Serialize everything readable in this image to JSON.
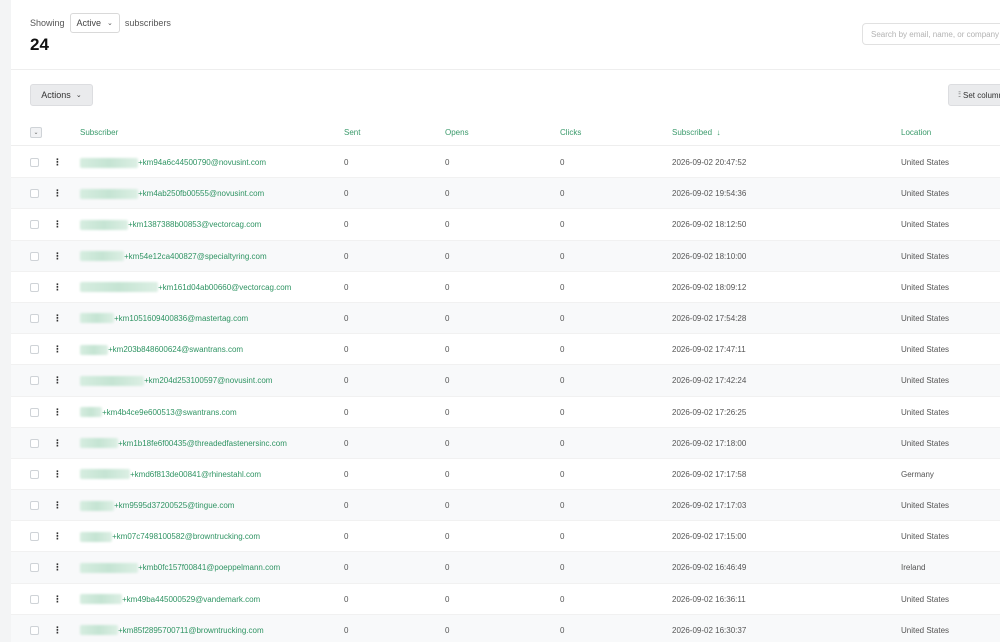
{
  "header": {
    "showing_label": "Showing",
    "status_value": "Active",
    "subscribers_label": "subscribers",
    "count": "24"
  },
  "search": {
    "placeholder": "Search by email, name, or company"
  },
  "toolbar": {
    "actions_label": "Actions",
    "set_columns_label": "Set columns"
  },
  "columns": {
    "subscriber": "Subscriber",
    "sent": "Sent",
    "opens": "Opens",
    "clicks": "Clicks",
    "subscribed": "Subscribed",
    "location": "Location"
  },
  "sort_indicator": "↓",
  "icons": {
    "kebab": "more-vertical-icon",
    "chevron": "chevron-down-icon",
    "columns": "sliders-icon"
  },
  "colors": {
    "accent": "#2f9463",
    "header_bg": "#eaebed"
  },
  "rows": [
    {
      "email": "+km94a6c44500790@novusint.com",
      "sent": "0",
      "opens": "0",
      "clicks": "0",
      "subscribed": "2026-09-02 20:47:52",
      "location": "United States"
    },
    {
      "email": "+km4ab250fb00555@novusint.com",
      "sent": "0",
      "opens": "0",
      "clicks": "0",
      "subscribed": "2026-09-02 19:54:36",
      "location": "United States"
    },
    {
      "email": "+km1387388b00853@vectorcag.com",
      "sent": "0",
      "opens": "0",
      "clicks": "0",
      "subscribed": "2026-09-02 18:12:50",
      "location": "United States"
    },
    {
      "email": "+km54e12ca400827@specialtyring.com",
      "sent": "0",
      "opens": "0",
      "clicks": "0",
      "subscribed": "2026-09-02 18:10:00",
      "location": "United States"
    },
    {
      "email": "+km161d04ab00660@vectorcag.com",
      "sent": "0",
      "opens": "0",
      "clicks": "0",
      "subscribed": "2026-09-02 18:09:12",
      "location": "United States"
    },
    {
      "email": "+km1051609400836@mastertag.com",
      "sent": "0",
      "opens": "0",
      "clicks": "0",
      "subscribed": "2026-09-02 17:54:28",
      "location": "United States"
    },
    {
      "email": "+km203b848600624@swantrans.com",
      "sent": "0",
      "opens": "0",
      "clicks": "0",
      "subscribed": "2026-09-02 17:47:11",
      "location": "United States"
    },
    {
      "email": "+km204d253100597@novusint.com",
      "sent": "0",
      "opens": "0",
      "clicks": "0",
      "subscribed": "2026-09-02 17:42:24",
      "location": "United States"
    },
    {
      "email": "+km4b4ce9e600513@swantrans.com",
      "sent": "0",
      "opens": "0",
      "clicks": "0",
      "subscribed": "2026-09-02 17:26:25",
      "location": "United States"
    },
    {
      "email": "+km1b18fe6f00435@threadedfastenersinc.com",
      "sent": "0",
      "opens": "0",
      "clicks": "0",
      "subscribed": "2026-09-02 17:18:00",
      "location": "United States"
    },
    {
      "email": "+kmd6f813de00841@rhinestahl.com",
      "sent": "0",
      "opens": "0",
      "clicks": "0",
      "subscribed": "2026-09-02 17:17:58",
      "location": "Germany"
    },
    {
      "email": "+km9595d37200525@tingue.com",
      "sent": "0",
      "opens": "0",
      "clicks": "0",
      "subscribed": "2026-09-02 17:17:03",
      "location": "United States"
    },
    {
      "email": "+km07c7498100582@browntrucking.com",
      "sent": "0",
      "opens": "0",
      "clicks": "0",
      "subscribed": "2026-09-02 17:15:00",
      "location": "United States"
    },
    {
      "email": "+kmb0fc157f00841@poeppelmann.com",
      "sent": "0",
      "opens": "0",
      "clicks": "0",
      "subscribed": "2026-09-02 16:46:49",
      "location": "Ireland"
    },
    {
      "email": "+km49ba445000529@vandemark.com",
      "sent": "0",
      "opens": "0",
      "clicks": "0",
      "subscribed": "2026-09-02 16:36:11",
      "location": "United States"
    },
    {
      "email": "+km85f2895700711@browntrucking.com",
      "sent": "0",
      "opens": "0",
      "clicks": "0",
      "subscribed": "2026-09-02 16:30:37",
      "location": "United States"
    }
  ]
}
